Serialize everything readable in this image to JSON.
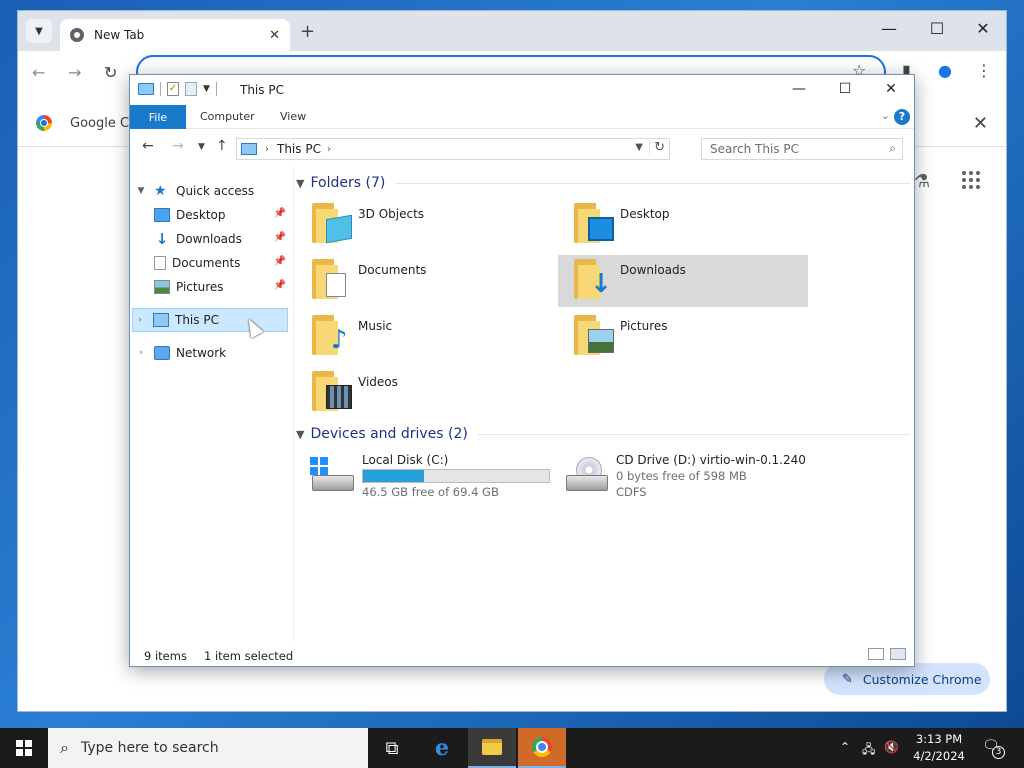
{
  "chrome": {
    "tab_title": "New Tab",
    "bookmark_label": "Google Ch",
    "customize_label": "Customize Chrome"
  },
  "explorer": {
    "title": "This PC",
    "ribbon": {
      "file": "File",
      "tabs": [
        "Computer",
        "View"
      ]
    },
    "address": {
      "location": "This PC",
      "search_placeholder": "Search This PC"
    },
    "nav": {
      "quick_access": "Quick access",
      "pinned": [
        {
          "label": "Desktop",
          "icon": "desktop-icon"
        },
        {
          "label": "Downloads",
          "icon": "downloads-icon"
        },
        {
          "label": "Documents",
          "icon": "documents-icon"
        },
        {
          "label": "Pictures",
          "icon": "pictures-icon"
        }
      ],
      "this_pc": "This PC",
      "network": "Network"
    },
    "folders_header": "Folders (7)",
    "folders": [
      {
        "label": "3D Objects",
        "icon": "3d-objects-icon"
      },
      {
        "label": "Desktop",
        "icon": "desktop-icon"
      },
      {
        "label": "Documents",
        "icon": "documents-icon"
      },
      {
        "label": "Downloads",
        "icon": "downloads-icon",
        "selected": true
      },
      {
        "label": "Music",
        "icon": "music-icon"
      },
      {
        "label": "Pictures",
        "icon": "pictures-icon"
      },
      {
        "label": "Videos",
        "icon": "videos-icon"
      }
    ],
    "drives_header": "Devices and drives (2)",
    "drives": [
      {
        "name": "Local Disk (C:)",
        "detail": "46.5 GB free of 69.4 GB",
        "used_fraction": 0.33
      },
      {
        "name": "CD Drive (D:) virtio-win-0.1.240",
        "detail": "0 bytes free of 598 MB",
        "fs": "CDFS"
      }
    ],
    "status": {
      "items": "9 items",
      "selected": "1 item selected"
    }
  },
  "taskbar": {
    "search_placeholder": "Type here to search",
    "time": "3:13 PM",
    "date": "4/2/2024",
    "notifications": "3"
  },
  "colors": {
    "accent": "#1979ca",
    "selection": "#cce8ff",
    "drive_fill": "#26a0da"
  }
}
